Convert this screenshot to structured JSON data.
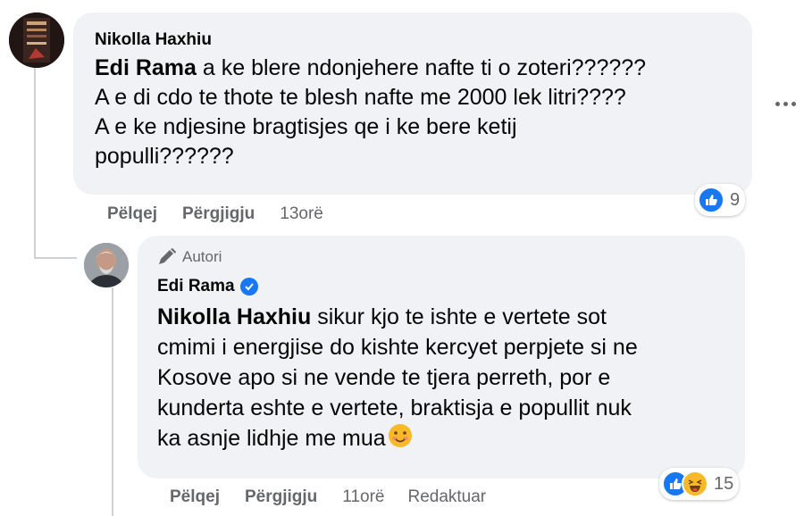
{
  "comment1": {
    "author": "Nikolla Haxhiu",
    "mention": "Edi Rama",
    "line1_rest": " a ke blere ndonjehere nafte ti o zoteri??????",
    "line2": "A e di cdo te thote te blesh nafte me 2000 lek litri????",
    "line3": "A e ke ndjesine bragtisjes qe i ke bere ketij",
    "line4": "populli??????",
    "reaction_count": "9",
    "like_label": "Pëlqej",
    "reply_label": "Përgjigju",
    "time": "13orë"
  },
  "comment2": {
    "badge": "Autori",
    "author": "Edi Rama",
    "mention": "Nikolla Haxhiu",
    "line1_rest": " sikur kjo te ishte e vertete sot",
    "line2": "cmimi i energjise do kishte kercyet perpjete si ne",
    "line3": "Kosove apo si ne vende te tjera perreth, por e",
    "line4": "kunderta eshte e vertete, braktisja e popullit nuk",
    "line5": "ka asnje lidhje me mua",
    "reaction_count": "15",
    "like_label": "Pëlqej",
    "reply_label": "Përgjigju",
    "time": "11orë",
    "edited_label": "Redaktuar"
  },
  "colors": {
    "bubble": "#f0f2f5",
    "secondary_text": "#65676b",
    "like_blue": "#1877f2",
    "haha_yellow": "#f7b928"
  },
  "icons": [
    "like-icon",
    "haha-icon",
    "verified-icon",
    "pencil-icon",
    "more-options-icon"
  ]
}
